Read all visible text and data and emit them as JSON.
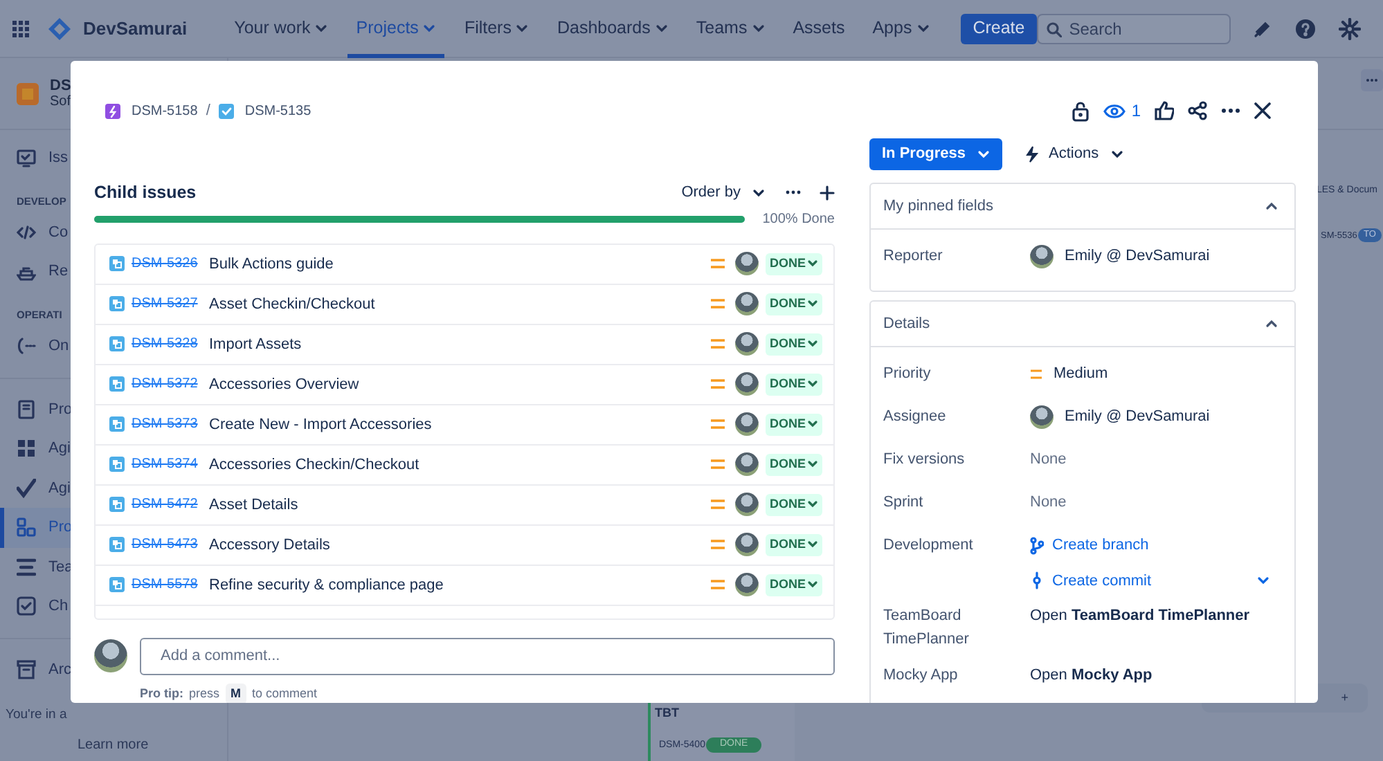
{
  "topnav": {
    "brand": "DevSamurai",
    "items": [
      {
        "label": "Your work",
        "dropdown": true,
        "selected": false
      },
      {
        "label": "Projects",
        "dropdown": true,
        "selected": true
      },
      {
        "label": "Filters",
        "dropdown": true,
        "selected": false
      },
      {
        "label": "Dashboards",
        "dropdown": true,
        "selected": false
      },
      {
        "label": "Teams",
        "dropdown": true,
        "selected": false
      },
      {
        "label": "Assets",
        "dropdown": false,
        "selected": false
      },
      {
        "label": "Apps",
        "dropdown": true,
        "selected": false
      }
    ],
    "create": "Create",
    "search": {
      "placeholder": "Search"
    }
  },
  "sidebar": {
    "project": {
      "name": "DS",
      "type": "Sof"
    },
    "items": [
      {
        "kind": "item",
        "label": "Iss",
        "selected": false
      },
      {
        "kind": "heading",
        "label": "DEVELOP"
      },
      {
        "kind": "item",
        "label": "Co",
        "selected": false
      },
      {
        "kind": "item",
        "label": "Re",
        "selected": false
      },
      {
        "kind": "heading",
        "label": "OPERATI"
      },
      {
        "kind": "item",
        "label": "On",
        "selected": false
      },
      {
        "kind": "divider"
      },
      {
        "kind": "item",
        "label": "Pro",
        "selected": false
      },
      {
        "kind": "item",
        "label": "Agi",
        "selected": false
      },
      {
        "kind": "item",
        "label": "Agi",
        "selected": false
      },
      {
        "kind": "item",
        "label": "Pro",
        "selected": true
      },
      {
        "kind": "item",
        "label": "Tea",
        "selected": false
      },
      {
        "kind": "item",
        "label": "Ch",
        "selected": false
      },
      {
        "kind": "divider"
      },
      {
        "kind": "item",
        "label": "Arc",
        "selected": false
      }
    ],
    "notice": "You're in a",
    "learn_more": "Learn more"
  },
  "board": {
    "column_header": "LES & Docum",
    "card": {
      "key": "SM-5536",
      "status": "TO"
    },
    "bottom_card": {
      "title": "TBT",
      "key": "DSM-5400",
      "status": "DONE"
    },
    "add": "+"
  },
  "issue": {
    "breadcrumb_separator": "/",
    "breadcrumb": [
      {
        "key": "DSM-5158",
        "kind": "epic"
      },
      {
        "key": "DSM-5135",
        "kind": "task"
      }
    ],
    "watchers": "1",
    "status": "In Progress",
    "actions": "Actions",
    "child_issues": {
      "title": "Child issues",
      "order_by": "Order by",
      "level": 1,
      "progress_label": "100% Done",
      "rows": [
        {
          "key": "DSM-5326",
          "summary": "Bulk Actions guide",
          "status": "DONE",
          "done": true
        },
        {
          "key": "DSM-5327",
          "summary": "Asset Checkin/Checkout",
          "status": "DONE",
          "done": true
        },
        {
          "key": "DSM-5328",
          "summary": "Import Assets",
          "status": "DONE",
          "done": true
        },
        {
          "key": "DSM-5372",
          "summary": "Accessories Overview",
          "status": "DONE",
          "done": true
        },
        {
          "key": "DSM-5373",
          "summary": "Create New - Import Accessories",
          "status": "DONE",
          "done": true
        },
        {
          "key": "DSM-5374",
          "summary": "Accessories Checkin/Checkout",
          "status": "DONE",
          "done": true
        },
        {
          "key": "DSM-5472",
          "summary": "Asset Details",
          "status": "DONE",
          "done": true
        },
        {
          "key": "DSM-5473",
          "summary": "Accessory Details",
          "status": "DONE",
          "done": true
        },
        {
          "key": "DSM-5578",
          "summary": "Refine security & compliance page",
          "status": "DONE",
          "done": true
        }
      ]
    },
    "comment": {
      "placeholder": "Add a comment...",
      "tip_label": "Pro tip:",
      "tip_before": "press",
      "tip_key": "M",
      "tip_after": "to comment"
    },
    "panels": [
      {
        "title": "My pinned fields",
        "expanded": true,
        "fields": [
          {
            "label": "Reporter",
            "kind": "user",
            "value": "Emily @ DevSamurai"
          }
        ]
      },
      {
        "title": "Details",
        "expanded": true,
        "fields": [
          {
            "label": "Priority",
            "kind": "priority",
            "value": "Medium"
          },
          {
            "label": "Assignee",
            "kind": "user",
            "value": "Emily @ DevSamurai"
          },
          {
            "label": "Fix versions",
            "kind": "none",
            "value": "None"
          },
          {
            "label": "Sprint",
            "kind": "none",
            "value": "None"
          },
          {
            "label": "Development",
            "kind": "links",
            "links": [
              {
                "kind": "branch",
                "label": "Create branch"
              },
              {
                "kind": "commit",
                "label": "Create commit"
              }
            ]
          },
          {
            "label": "TeamBoard TimePlanner",
            "kind": "app",
            "value": "Open **TeamBoard TimePlanner**"
          },
          {
            "label": "Mocky App",
            "kind": "app",
            "value": "Open **Mocky App**"
          }
        ]
      }
    ]
  }
}
